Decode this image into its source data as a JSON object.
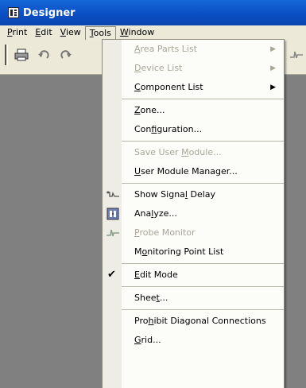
{
  "window": {
    "title": "Designer"
  },
  "menubar": [
    {
      "pre": "",
      "u": "P",
      "post": "rint"
    },
    {
      "pre": "",
      "u": "E",
      "post": "dit"
    },
    {
      "pre": "",
      "u": "V",
      "post": "iew"
    },
    {
      "pre": "",
      "u": "T",
      "post": "ools"
    },
    {
      "pre": "",
      "u": "W",
      "post": "indow"
    }
  ],
  "tools_menu": {
    "items": [
      {
        "pre": "",
        "u": "A",
        "post": "rea Parts List",
        "disabled": true,
        "submenu": true
      },
      {
        "pre": "",
        "u": "D",
        "post": "evice List",
        "disabled": true,
        "submenu": true
      },
      {
        "pre": "",
        "u": "C",
        "post": "omponent List",
        "disabled": false,
        "submenu": true
      },
      {
        "pre": "",
        "u": "Z",
        "post": "one...",
        "disabled": false
      },
      {
        "pre": "Con",
        "u": "f",
        "post": "iguration...",
        "disabled": false
      },
      {
        "pre": "Save User ",
        "u": "M",
        "post": "odule...",
        "disabled": true
      },
      {
        "pre": "",
        "u": "U",
        "post": "ser Module Manager...",
        "disabled": false
      },
      {
        "pre": "Show Signa",
        "u": "l",
        "post": " Delay",
        "disabled": false,
        "icon": "signal-delay-icon"
      },
      {
        "pre": "Ana",
        "u": "l",
        "post": "yze...",
        "disabled": false,
        "icon": "analyze-icon"
      },
      {
        "pre": "",
        "u": "P",
        "post": "robe Monitor",
        "disabled": true,
        "icon": "probe-monitor-icon"
      },
      {
        "pre": "M",
        "u": "o",
        "post": "nitoring Point List",
        "disabled": false
      },
      {
        "pre": "",
        "u": "E",
        "post": "dit Mode",
        "disabled": false,
        "checked": true
      },
      {
        "pre": "Shee",
        "u": "t",
        "post": "...",
        "disabled": false
      },
      {
        "pre": "Pro",
        "u": "h",
        "post": "ibit Diagonal Connections",
        "disabled": false
      },
      {
        "pre": "",
        "u": "G",
        "post": "rid...",
        "disabled": false
      }
    ]
  }
}
